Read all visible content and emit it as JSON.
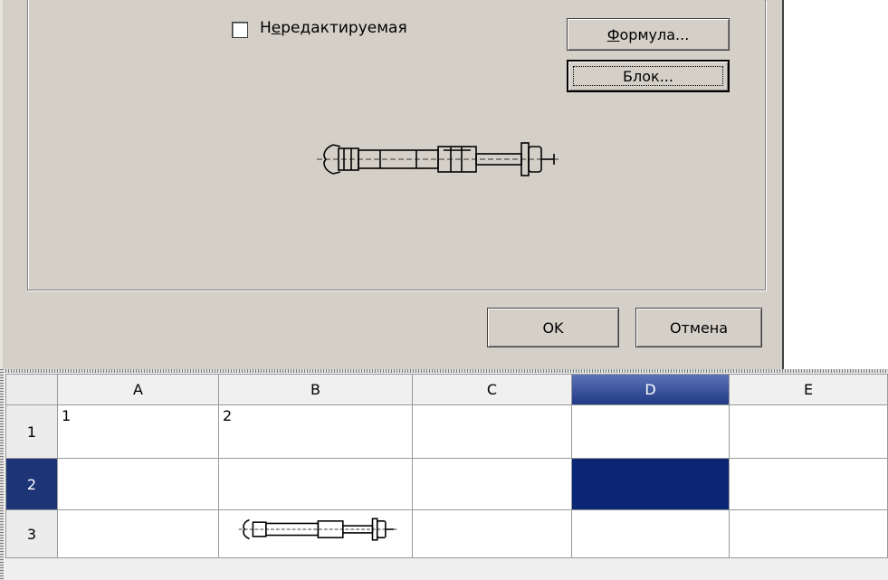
{
  "dialog": {
    "readonly_checkbox": {
      "label": "Нередактируемая",
      "checked": false
    },
    "formula_button": "Формула...",
    "block_button": "Блок...",
    "preview_icon": "anchor-bolt-drawing-icon",
    "ok_button": "OK",
    "cancel_button": "Отмена"
  },
  "sheet": {
    "columns": [
      "A",
      "B",
      "C",
      "D",
      "E"
    ],
    "rows": [
      "1",
      "2",
      "3"
    ],
    "selected_column": "D",
    "selected_row": "2",
    "selection_color": "#0c2676",
    "cells": {
      "A1": "1",
      "B1": "2",
      "B3_icon": "anchor-bolt-drawing-icon"
    }
  }
}
